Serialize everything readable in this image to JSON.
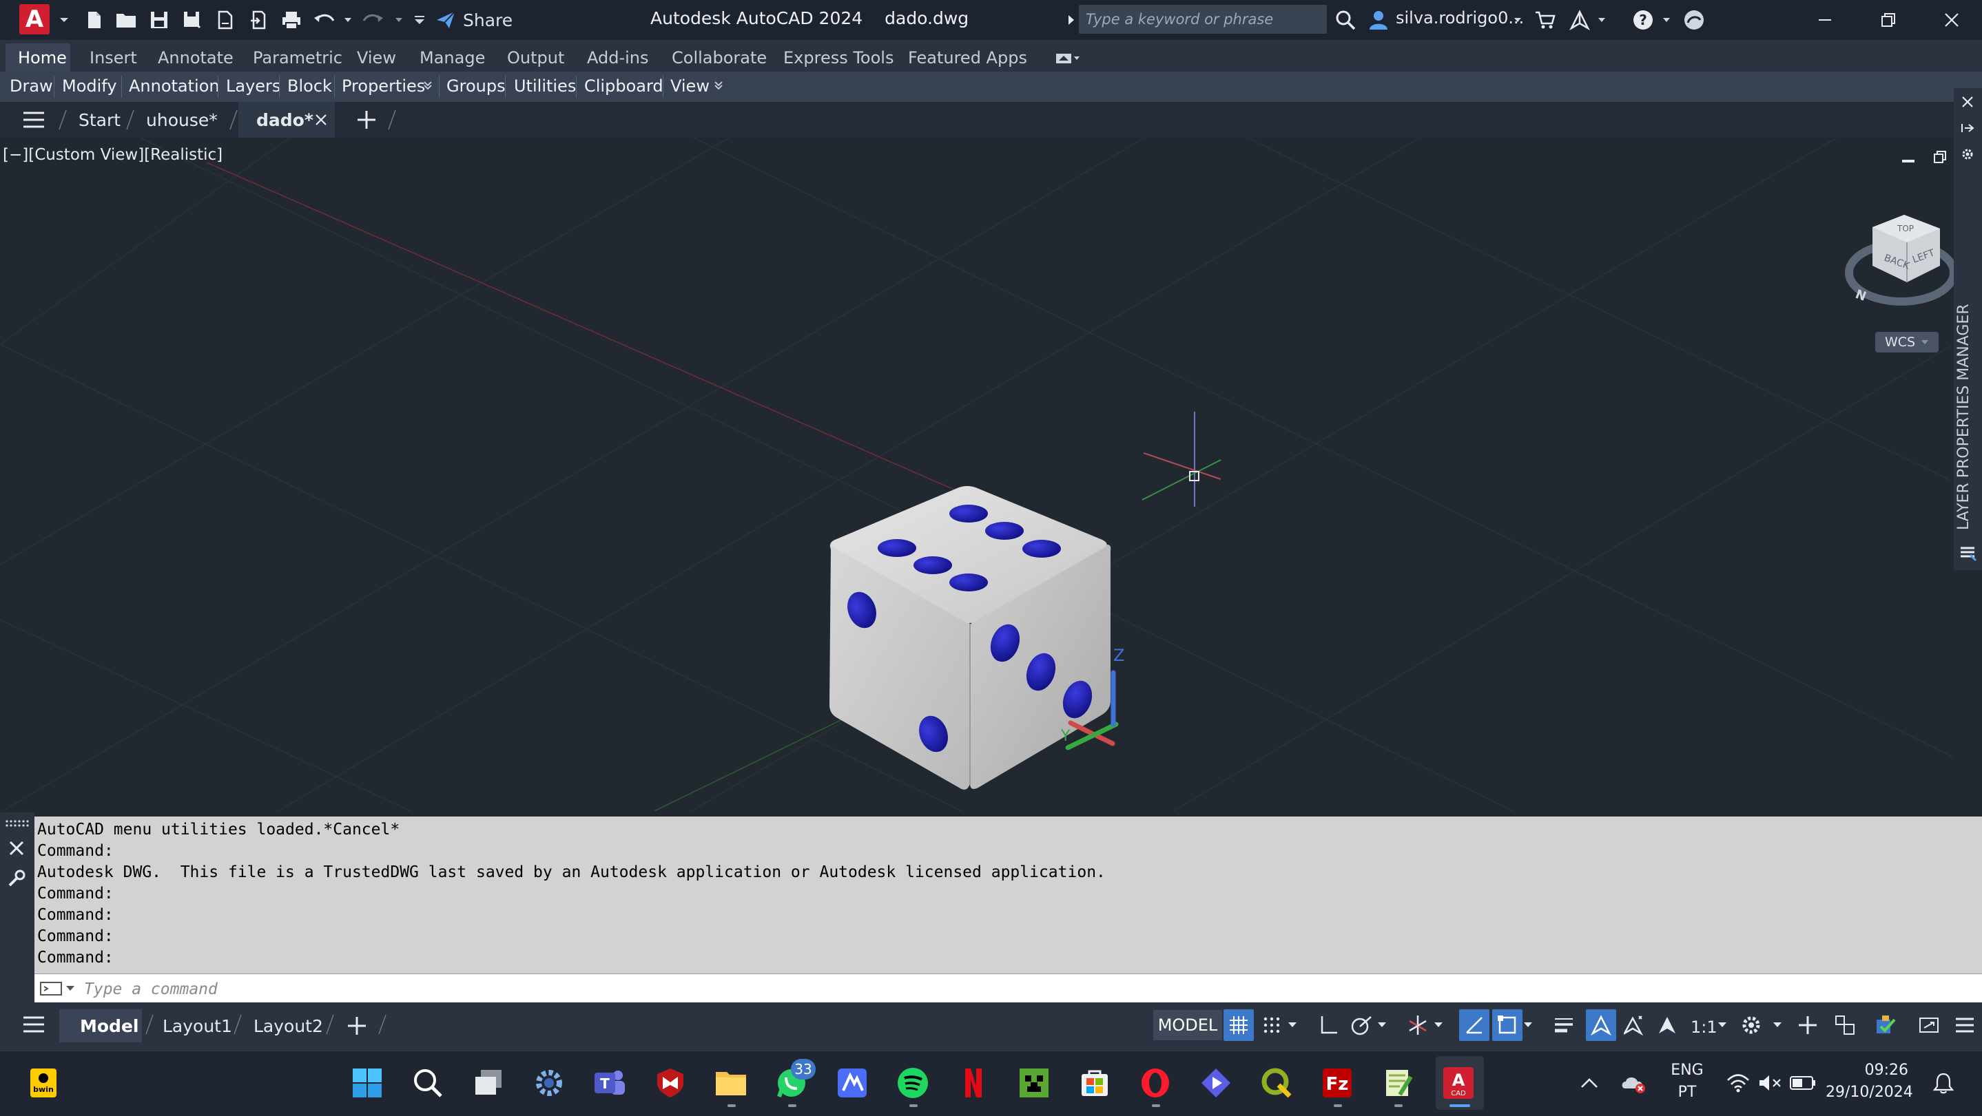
{
  "titlebar": {
    "app_title": "Autodesk AutoCAD 2024",
    "file_name": "dado.dwg",
    "share_label": "Share",
    "search_placeholder": "Type a keyword or phrase",
    "user_name": "silva.rodrigo0...",
    "app_logo_letter": "A"
  },
  "ribbon": {
    "tabs": [
      "Home",
      "Insert",
      "Annotate",
      "Parametric",
      "View",
      "Manage",
      "Output",
      "Add-ins",
      "Collaborate",
      "Express Tools",
      "Featured Apps"
    ],
    "active_tab": "Home",
    "panels": [
      "Draw",
      "Modify",
      "Annotation",
      "Layers",
      "Block",
      "Properties",
      "Groups",
      "Utilities",
      "Clipboard",
      "View"
    ]
  },
  "file_tabs": {
    "items": [
      "Start",
      "uhouse*",
      "dado*"
    ],
    "active": "dado*"
  },
  "viewport": {
    "view_label": "[−][Custom View][Realistic]",
    "viewcube": {
      "face_top": "TOP",
      "face_back": "BACK",
      "face_left": "LEFT",
      "compass_n": "N"
    },
    "wcs_label": "WCS",
    "ucs": {
      "z_label": "Z",
      "y_label": "Y"
    }
  },
  "palette": {
    "title": "LAYER PROPERTIES MANAGER"
  },
  "command": {
    "history": [
      "AutoCAD menu utilities loaded.*Cancel*",
      "Command:",
      "Autodesk DWG.  This file is a TrustedDWG last saved by an Autodesk application or Autodesk licensed application.",
      "Command:",
      "Command:",
      "Command:",
      "Command:"
    ],
    "input_placeholder": "Type a command"
  },
  "statusbar": {
    "layout_tabs": [
      "Model",
      "Layout1",
      "Layout2"
    ],
    "active_layout": "Model",
    "model_indicator": "MODEL",
    "annotation_scale": "1:1"
  },
  "taskbar": {
    "whatsapp_badge": "33",
    "bwin_label": "bwin",
    "autocad_label": "CAD",
    "lang_primary": "ENG",
    "lang_secondary": "PT",
    "time": "09:26",
    "date": "29/10/2024"
  },
  "colors": {
    "viewport_bg": "#212830",
    "die_face": "#c9c9c9",
    "pip": "#1b1ba8",
    "accent_blue": "#3d78c9",
    "autocad_red": "#d0202f"
  }
}
